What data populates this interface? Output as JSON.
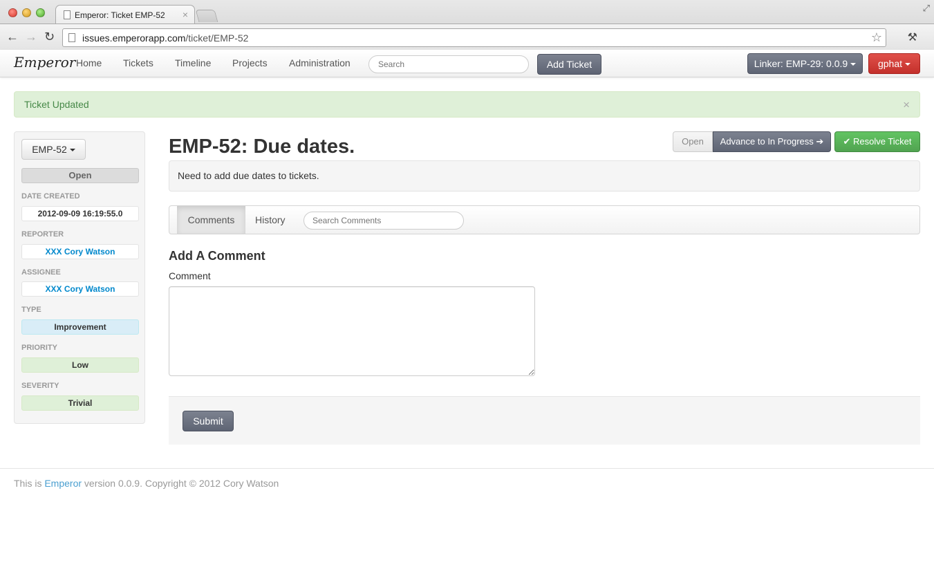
{
  "browser": {
    "tab_title": "Emperor: Ticket EMP-52",
    "tab_close": "×",
    "url_host": "issues.emperorapp.com",
    "url_path": "/ticket/EMP-52",
    "back": "←",
    "forward": "→",
    "reload": "↻",
    "star": "☆",
    "tools": "⚒"
  },
  "navbar": {
    "brand": "Emperor",
    "links": [
      "Home",
      "Tickets",
      "Timeline",
      "Projects",
      "Administration"
    ],
    "search_placeholder": "Search",
    "add_ticket": "Add Ticket",
    "linker": "Linker: EMP-29: 0.0.9",
    "user": "gphat"
  },
  "alert": {
    "message": "Ticket Updated",
    "close": "×"
  },
  "sidebar": {
    "ticket_id": "EMP-52",
    "status": "Open",
    "date_created_label": "DATE CREATED",
    "date_created": "2012-09-09 16:19:55.0",
    "reporter_label": "REPORTER",
    "reporter": "XXX Cory Watson",
    "assignee_label": "ASSIGNEE",
    "assignee": "XXX Cory Watson",
    "type_label": "TYPE",
    "type": "Improvement",
    "priority_label": "PRIORITY",
    "priority": "Low",
    "severity_label": "SEVERITY",
    "severity": "Trivial"
  },
  "ticket": {
    "title": "EMP-52: Due dates.",
    "status_button": "Open",
    "advance_button": "Advance to In Progress",
    "advance_arrow": "➔",
    "resolve_check": "✔",
    "resolve_button": "Resolve Ticket",
    "description": "Need to add due dates to tickets."
  },
  "tabs": {
    "comments": "Comments",
    "history": "History",
    "search_placeholder": "Search Comments"
  },
  "comment_form": {
    "heading": "Add A Comment",
    "label": "Comment",
    "value": "",
    "submit": "Submit"
  },
  "footer": {
    "prefix": "This is ",
    "app_link": "Emperor",
    "suffix": " version 0.0.9. Copyright © 2012 Cory Watson"
  },
  "colors": {
    "dark_button": "#5e6474",
    "danger": "#c4302b",
    "success": "#51a351",
    "alert_bg": "#dff0d8",
    "link": "#0088cc"
  }
}
